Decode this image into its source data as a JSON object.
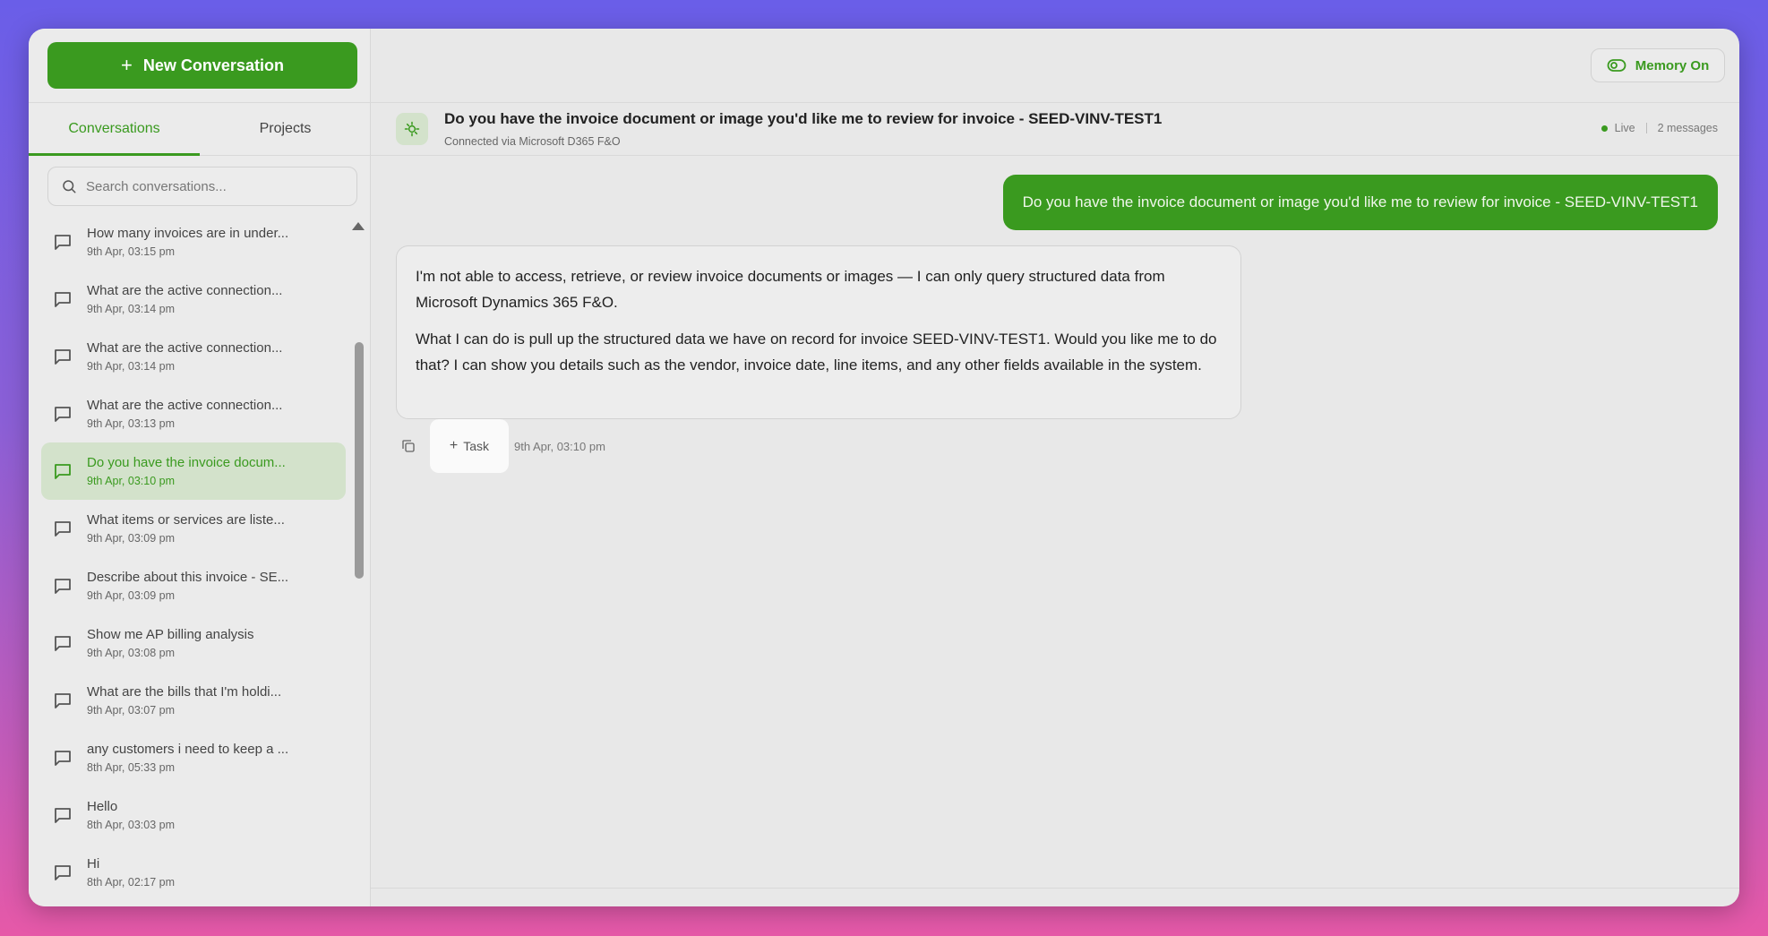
{
  "sidebar": {
    "new_conversation_label": "New Conversation",
    "tabs": [
      {
        "label": "Conversations",
        "active": true
      },
      {
        "label": "Projects",
        "active": false
      }
    ],
    "search_placeholder": "Search conversations...",
    "conversations": [
      {
        "title": "How many invoices are in under...",
        "date": "9th Apr, 03:15 pm"
      },
      {
        "title": "What are the active connection...",
        "date": "9th Apr, 03:14 pm"
      },
      {
        "title": "What are the active connection...",
        "date": "9th Apr, 03:14 pm"
      },
      {
        "title": "What are the active connection...",
        "date": "9th Apr, 03:13 pm"
      },
      {
        "title": "Do you have the invoice docum...",
        "date": "9th Apr, 03:10 pm",
        "active": true
      },
      {
        "title": "What items or services are liste...",
        "date": "9th Apr, 03:09 pm"
      },
      {
        "title": "Describe about this invoice - SE...",
        "date": "9th Apr, 03:09 pm"
      },
      {
        "title": "Show me AP billing analysis",
        "date": "9th Apr, 03:08 pm"
      },
      {
        "title": "What are the bills that I'm holdi...",
        "date": "9th Apr, 03:07 pm"
      },
      {
        "title": "any customers i need to keep a ...",
        "date": "8th Apr, 05:33 pm"
      },
      {
        "title": "Hello",
        "date": "8th Apr, 03:03 pm"
      },
      {
        "title": "Hi",
        "date": "8th Apr, 02:17 pm"
      }
    ]
  },
  "header": {
    "memory_label": "Memory On",
    "chat_title": "Do you have the invoice document or image you'd like me to review for invoice - SEED-VINV-TEST1",
    "chat_subtitle": "Connected via Microsoft D365 F&O",
    "status": "Live",
    "message_count": "2 messages"
  },
  "messages": {
    "user": "Do you have the invoice document or image you'd like me to review for invoice - SEED-VINV-TEST1",
    "assistant_p1": "I'm not able to access, retrieve, or review invoice documents or images — I can only query structured data from Microsoft Dynamics 365 F&O.",
    "assistant_p2": "What I can do is pull up the structured data we have on record for invoice SEED-VINV-TEST1. Would you like me to do that? I can show you details such as the vendor, invoice date, line items, and any other fields available in the system.",
    "task_label": "Task",
    "timestamp": "9th Apr, 03:10 pm"
  },
  "colors": {
    "accent": "#3a9a1f",
    "active_bg": "#d3e2cb",
    "background": "#e8e8e8"
  },
  "icons": {
    "new_conversation": "plus-icon",
    "search": "search-icon",
    "conversation": "chat-bubble-icon",
    "memory": "toggle-icon",
    "header": "agent-icon",
    "copy": "copy-icon",
    "task": "plus-icon"
  }
}
